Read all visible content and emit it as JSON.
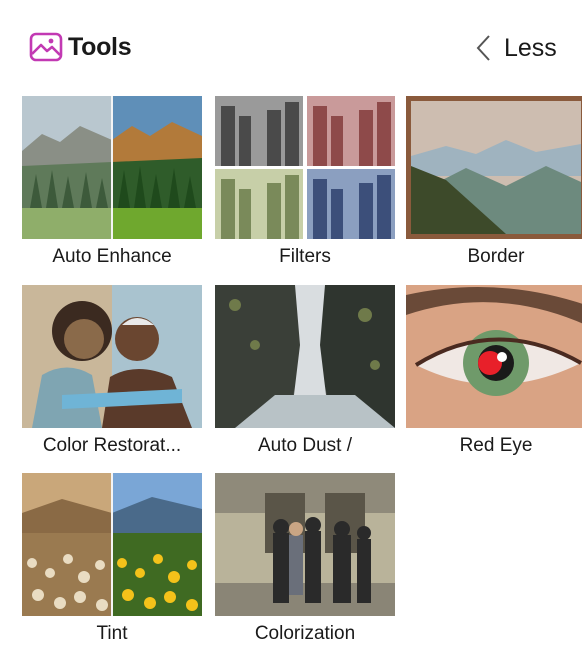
{
  "header": {
    "title": "Tools",
    "title_icon": "photo-tools-icon",
    "less_label": "Less",
    "less_icon": "chevron-left-icon"
  },
  "tools": [
    {
      "label": "Auto Enhance",
      "icon": "auto-enhance-thumbnail"
    },
    {
      "label": "Filters",
      "icon": "filters-thumbnail"
    },
    {
      "label": "Border",
      "icon": "border-thumbnail"
    },
    {
      "label": "Color Restorat...",
      "icon": "color-restoration-thumbnail"
    },
    {
      "label": "Auto Dust /",
      "icon": "auto-dust-thumbnail"
    },
    {
      "label": "Red Eye",
      "icon": "red-eye-thumbnail"
    },
    {
      "label": "Tint",
      "icon": "tint-thumbnail"
    },
    {
      "label": "Colorization",
      "icon": "colorization-thumbnail"
    }
  ],
  "colors": {
    "accent": "#c239b3",
    "text": "#1a1a1a",
    "background": "#ffffff",
    "border_frame": "#8a5a3c"
  }
}
